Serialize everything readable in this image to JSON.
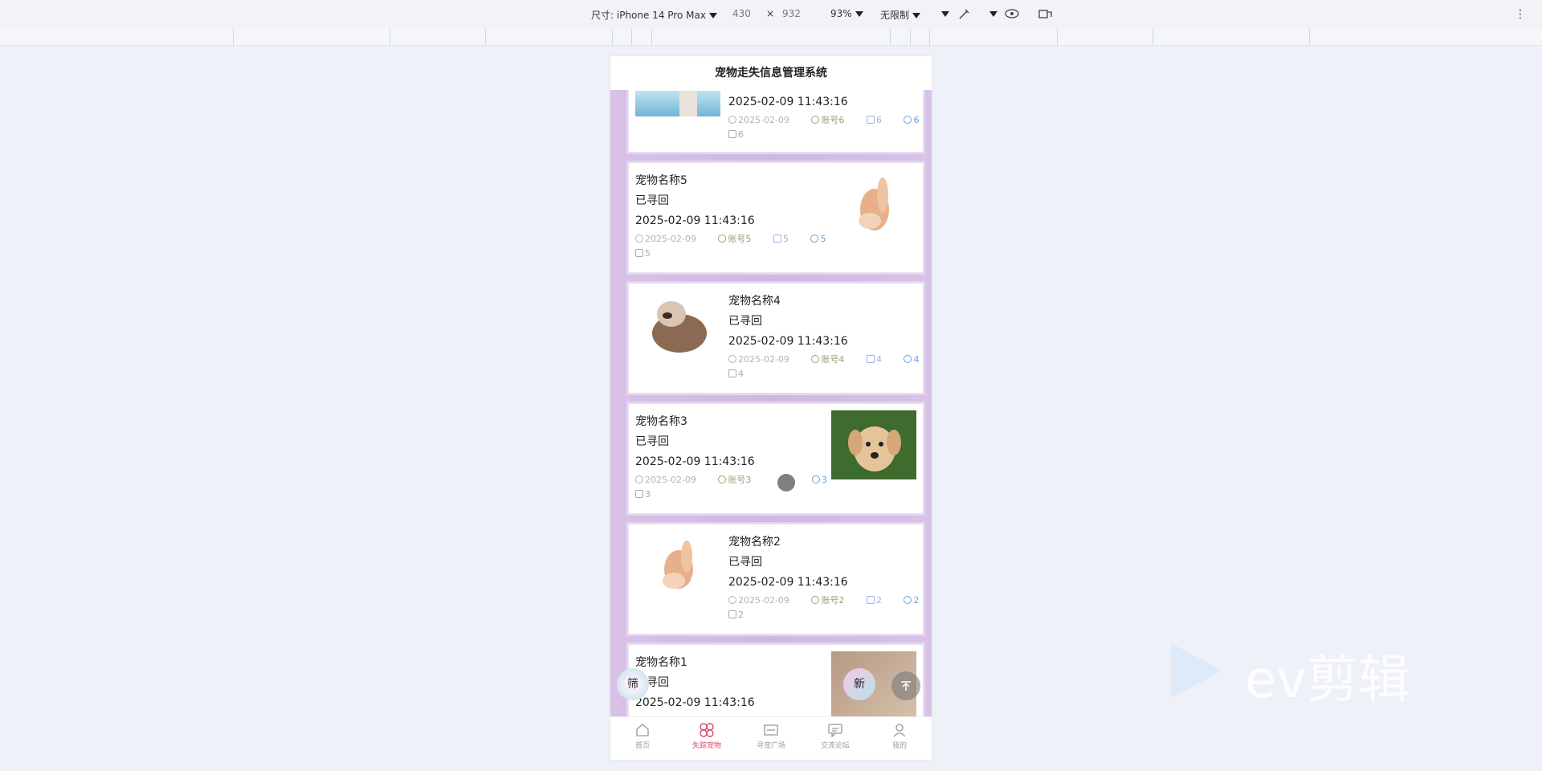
{
  "devtools": {
    "device_label": "尺寸: iPhone 14 Pro Max",
    "width": "430",
    "times": "×",
    "height": "932",
    "zoom": "93%",
    "throttle": "无限制"
  },
  "app": {
    "title": "宠物走失信息管理系统"
  },
  "cards": [
    {
      "name": "",
      "status": "",
      "time": "2025-02-09 11:43:16",
      "date": "2025-02-09",
      "user": "账号6",
      "likes": "6",
      "favs": "6",
      "comments": "6"
    },
    {
      "name": "宠物名称5",
      "status": "已寻回",
      "time": "2025-02-09 11:43:16",
      "date": "2025-02-09",
      "user": "账号5",
      "likes": "5",
      "favs": "5",
      "comments": "5"
    },
    {
      "name": "宠物名称4",
      "status": "已寻回",
      "time": "2025-02-09 11:43:16",
      "date": "2025-02-09",
      "user": "账号4",
      "likes": "4",
      "favs": "4",
      "comments": "4"
    },
    {
      "name": "宠物名称3",
      "status": "已寻回",
      "time": "2025-02-09 11:43:16",
      "date": "2025-02-09",
      "user": "账号3",
      "likes": "",
      "favs": "3",
      "comments": "3"
    },
    {
      "name": "宠物名称2",
      "status": "已寻回",
      "time": "2025-02-09 11:43:16",
      "date": "2025-02-09",
      "user": "账号2",
      "likes": "2",
      "favs": "2",
      "comments": "2"
    },
    {
      "name": "宠物名称1",
      "status": "寻回",
      "time": "2025-02-09 11:43:16"
    }
  ],
  "fabs": {
    "filter": "筛",
    "new": "新"
  },
  "tabs": [
    {
      "label": "首页",
      "icon": "home-icon"
    },
    {
      "label": "失踪宠物",
      "icon": "clover-icon"
    },
    {
      "label": "寻宠广场",
      "icon": "board-icon"
    },
    {
      "label": "交流论坛",
      "icon": "chat-icon"
    },
    {
      "label": "我的",
      "icon": "user-icon"
    }
  ],
  "watermark": "ev剪辑",
  "colors": {
    "active_tab": "#d9486a",
    "list_bg": "#d8c2e8"
  }
}
